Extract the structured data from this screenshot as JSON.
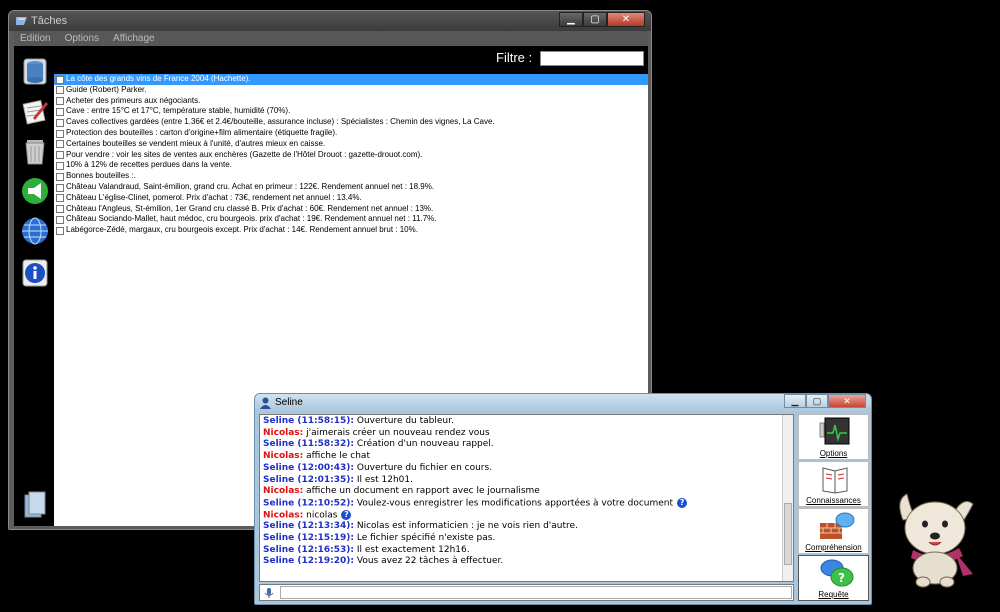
{
  "taches_window": {
    "title": "Tâches",
    "menu": [
      "Edition",
      "Options",
      "Affichage"
    ],
    "filter_label": "Filtre :",
    "filter_value": "",
    "tools": [
      "database-icon",
      "edit-icon",
      "trash-icon",
      "megaphone-icon",
      "globe-icon",
      "info-icon",
      "files-icon"
    ],
    "tasks": [
      "La côte des grands vins de France 2004 (Hachette).",
      "Guide (Robert) Parker.",
      "Acheter des primeurs aux négociants.",
      "Cave : entre 15°C et 17°C, température stable, humidité (70%).",
      "Caves collectives gardées (entre 1.36€ et 2.4€/bouteille, assurance incluse) : Spécialistes : Chemin des vignes, La Cave.",
      "Protection des bouteilles : carton d'origine+film alimentaire (étiquette fragile).",
      "Certaines bouteilles se vendent mieux à l'unité, d'autres mieux en caisse.",
      "Pour vendre : voir les sites de ventes aux enchères (Gazette de l'Hôtel Drouot : gazette-drouot.com).",
      "10% à 12% de recettes perdues dans la vente.",
      "Bonnes bouteilles :.",
      "Château Valandraud, Saint-émilion, grand cru. Achat en primeur : 122€. Rendement annuel net : 18.9%.",
      "Château L'église-Clinet, pomerol. Prix d'achat : 73€, rendement net annuel : 13.4%.",
      "Château l'Angleus, St-émilion, 1er Grand cru classé B. Prix d'achat : 60€. Rendement net annuel : 13%.",
      "Château Sociando-Mallet, haut médoc, cru bourgeois. prix d'achat : 19€. Rendement annuel net : 11.7%.",
      "Labégorce-Zédé, margaux, cru bourgeois except. Prix d'achat : 14€. Rendement annuel brut : 10%."
    ]
  },
  "seline_window": {
    "title": "Seline",
    "messages": [
      {
        "who": "Seline (11:58:15):",
        "text": " Ouverture du tableur.",
        "speaker": "seline",
        "help": false
      },
      {
        "who": "Nicolas:",
        "text": " j'aimerais créer un nouveau rendez vous",
        "speaker": "nicolas",
        "help": false
      },
      {
        "who": "Seline (11:58:32):",
        "text": " Création d'un nouveau rappel.",
        "speaker": "seline",
        "help": false
      },
      {
        "who": "Nicolas:",
        "text": " affiche le chat",
        "speaker": "nicolas",
        "help": false
      },
      {
        "who": "Seline (12:00:43):",
        "text": " Ouverture du fichier en cours.",
        "speaker": "seline",
        "help": false
      },
      {
        "who": "Seline (12:01:35):",
        "text": " Il est 12h01.",
        "speaker": "seline",
        "help": false
      },
      {
        "who": "Nicolas:",
        "text": " affiche un document en rapport avec le journalisme",
        "speaker": "nicolas",
        "help": false
      },
      {
        "who": "Seline (12:10:52):",
        "text": " Voulez-vous enregistrer les modifications apportées à votre document",
        "speaker": "seline",
        "help": true
      },
      {
        "who": "Nicolas:",
        "text": " nicolas",
        "speaker": "nicolas",
        "help": true
      },
      {
        "who": "Seline (12:13:34):",
        "text": " Nicolas est informaticien : je ne vois rien d'autre.",
        "speaker": "seline",
        "help": false
      },
      {
        "who": "Seline (12:15:19):",
        "text": " Le fichier spécifié n'existe pas.",
        "speaker": "seline",
        "help": false
      },
      {
        "who": "Seline (12:16:53):",
        "text": " Il est exactement 12h16.",
        "speaker": "seline",
        "help": false
      },
      {
        "who": "Seline (12:19:20):",
        "text": " Vous avez 22 tâches à effectuer.",
        "speaker": "seline",
        "help": false
      }
    ],
    "input_value": "",
    "side_buttons": [
      "Options",
      "Connaissances",
      "Compréhension",
      "Requête"
    ]
  },
  "colors": {
    "seline_name": "#2030c8",
    "nicolas_name": "#e01010",
    "selection": "#3399ff"
  }
}
